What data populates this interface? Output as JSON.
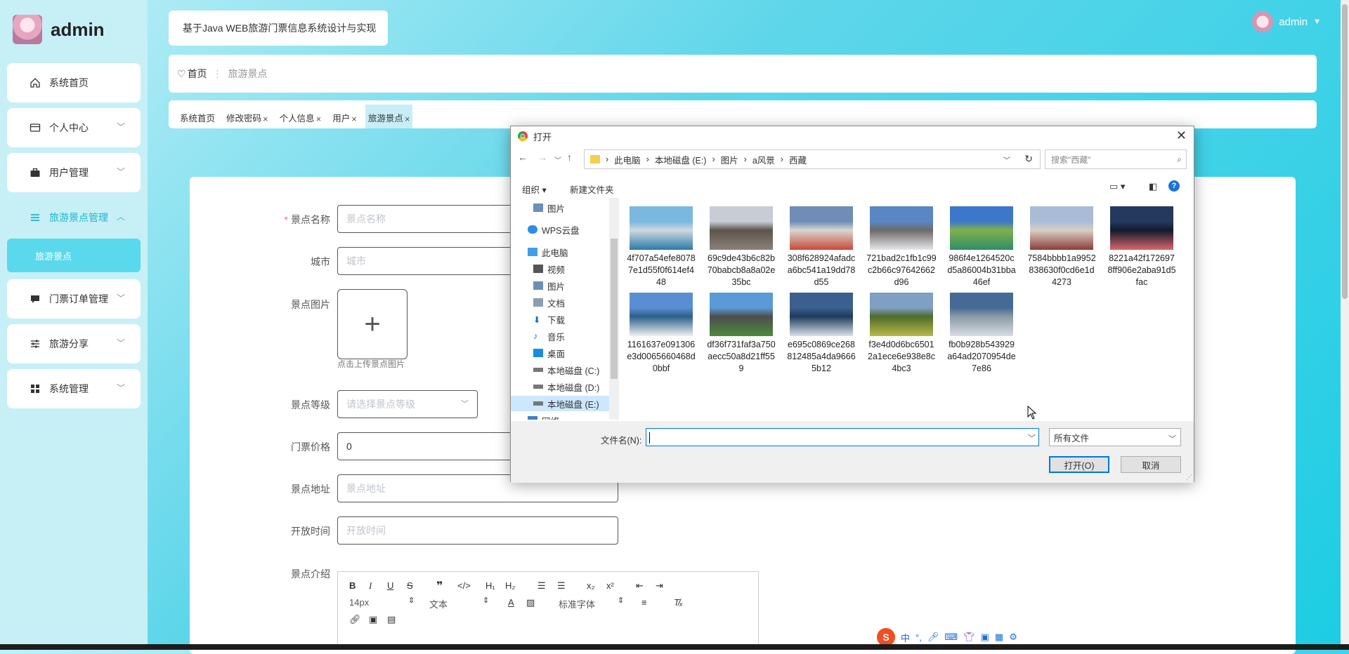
{
  "sidebar": {
    "brand": "admin",
    "items": [
      {
        "label": "系统首页",
        "icon": "home-icon"
      },
      {
        "label": "个人中心",
        "icon": "wallet-icon"
      },
      {
        "label": "用户管理",
        "icon": "briefcase-icon"
      },
      {
        "label": "旅游景点管理",
        "icon": "list-icon"
      },
      {
        "label": "门票订单管理",
        "icon": "chat-icon"
      },
      {
        "label": "旅游分享",
        "icon": "sliders-icon"
      },
      {
        "label": "系统管理",
        "icon": "grid-icon"
      }
    ],
    "submenu": "旅游景点"
  },
  "header": {
    "system_title": "基于Java WEB旅游门票信息系统设计与实现",
    "user": "admin"
  },
  "breadcrumb": {
    "home": "首页",
    "current": "旅游景点"
  },
  "tags": [
    {
      "label": "系统首页",
      "closable": false
    },
    {
      "label": "修改密码",
      "closable": true
    },
    {
      "label": "个人信息",
      "closable": true
    },
    {
      "label": "用户",
      "closable": true
    },
    {
      "label": "旅游景点",
      "closable": true,
      "active": true
    }
  ],
  "form": {
    "name_label": "景点名称",
    "name_placeholder": "景点名称",
    "city_label": "城市",
    "city_placeholder": "城市",
    "image_label": "景点图片",
    "upload_hint": "点击上传景点图片",
    "level_label": "景点等级",
    "level_placeholder": "请选择景点等级",
    "price_label": "门票价格",
    "price_value": "0",
    "address_label": "景点地址",
    "address_placeholder": "景点地址",
    "open_label": "开放时间",
    "open_placeholder": "开放时间",
    "intro_label": "景点介绍",
    "editor": {
      "font_size": "14px",
      "block": "文本",
      "font": "标准字体"
    }
  },
  "dialog": {
    "title": "打开",
    "path": [
      "此电脑",
      "本地磁盘 (E:)",
      "图片",
      "a风景",
      "西藏"
    ],
    "search_placeholder": "搜索\"西藏\"",
    "organize": "组织",
    "new_folder": "新建文件夹",
    "nav": [
      {
        "label": "图片",
        "icon": "picture-folder-icon"
      },
      {
        "label": "WPS云盘",
        "icon": "cloud-icon"
      },
      {
        "label": "此电脑",
        "icon": "computer-icon"
      },
      {
        "label": "视频",
        "icon": "video-folder-icon"
      },
      {
        "label": "图片",
        "icon": "picture-folder-icon"
      },
      {
        "label": "文档",
        "icon": "document-folder-icon"
      },
      {
        "label": "下载",
        "icon": "download-icon"
      },
      {
        "label": "音乐",
        "icon": "music-icon"
      },
      {
        "label": "桌面",
        "icon": "desktop-icon"
      },
      {
        "label": "本地磁盘 (C:)",
        "icon": "drive-icon"
      },
      {
        "label": "本地磁盘 (D:)",
        "icon": "drive-icon"
      },
      {
        "label": "本地磁盘 (E:)",
        "icon": "drive-icon"
      },
      {
        "label": "网络",
        "icon": "network-icon"
      }
    ],
    "files": [
      {
        "name": "4f707a54efe80787e1d55f0f614ef448",
        "colors": [
          "#7ab8e0",
          "#2a7aa8",
          "#cfd9df"
        ]
      },
      {
        "name": "69c9de43b6c82b70babcb8a8a02e35bc",
        "colors": [
          "#c7cdd4",
          "#8a8178",
          "#5c544b"
        ]
      },
      {
        "name": "308f628924afadca6bc541a19dd78d55",
        "colors": [
          "#6f8db6",
          "#c94a3a",
          "#d8d6d0"
        ]
      },
      {
        "name": "721bad2c1fb1c99c2b66c97642662d96",
        "colors": [
          "#5b86c4",
          "#e6e6ea",
          "#6d6a66"
        ]
      },
      {
        "name": "986f4e1264520cd5a86004b31bba46ef",
        "colors": [
          "#3d77c9",
          "#2f8c6a",
          "#7fb04b"
        ]
      },
      {
        "name": "7584bbbb1a9952838630f0cd6e1d4273",
        "colors": [
          "#a8bcd7",
          "#8a3d3a",
          "#d9cfc4"
        ]
      },
      {
        "name": "8221a42f1726978ff906e2aba91d5fac",
        "colors": [
          "#25395f",
          "#d8666a",
          "#111a2c"
        ]
      },
      {
        "name": "1161637e091306e3d0065660468d0bbf",
        "colors": [
          "#5a8ed2",
          "#f1f1f0",
          "#2c5e8c"
        ]
      },
      {
        "name": "df36f731faf3a750aecc50a8d21ff559",
        "colors": [
          "#5a9ad6",
          "#4c8c3f",
          "#4d4d4d"
        ]
      },
      {
        "name": "e695c0869ce268812485a4da96665b12",
        "colors": [
          "#3b5f8f",
          "#dbe2ea",
          "#1e3b5c"
        ]
      },
      {
        "name": "f3e4d0d6bc65012a1ece6e938e8c4bc3",
        "colors": [
          "#7f9fc3",
          "#b9b94a",
          "#4e6b2d"
        ]
      },
      {
        "name": "fb0b928b543929a64ad2070954de7e86",
        "colors": [
          "#456a96",
          "#d9dee3",
          "#8a9aa7"
        ]
      }
    ],
    "filename_label": "文件名(N):",
    "filename_value": "",
    "filetype": "所有文件",
    "open_button": "打开(O)",
    "cancel_button": "取消"
  },
  "ime": {
    "mode": "中",
    "logo": "S"
  },
  "colors": {
    "accent": "#21b5d0",
    "submenu_bg": "#5ad8ec",
    "tag_active": "#c7eef6",
    "dialog_accent": "#0078d7"
  }
}
